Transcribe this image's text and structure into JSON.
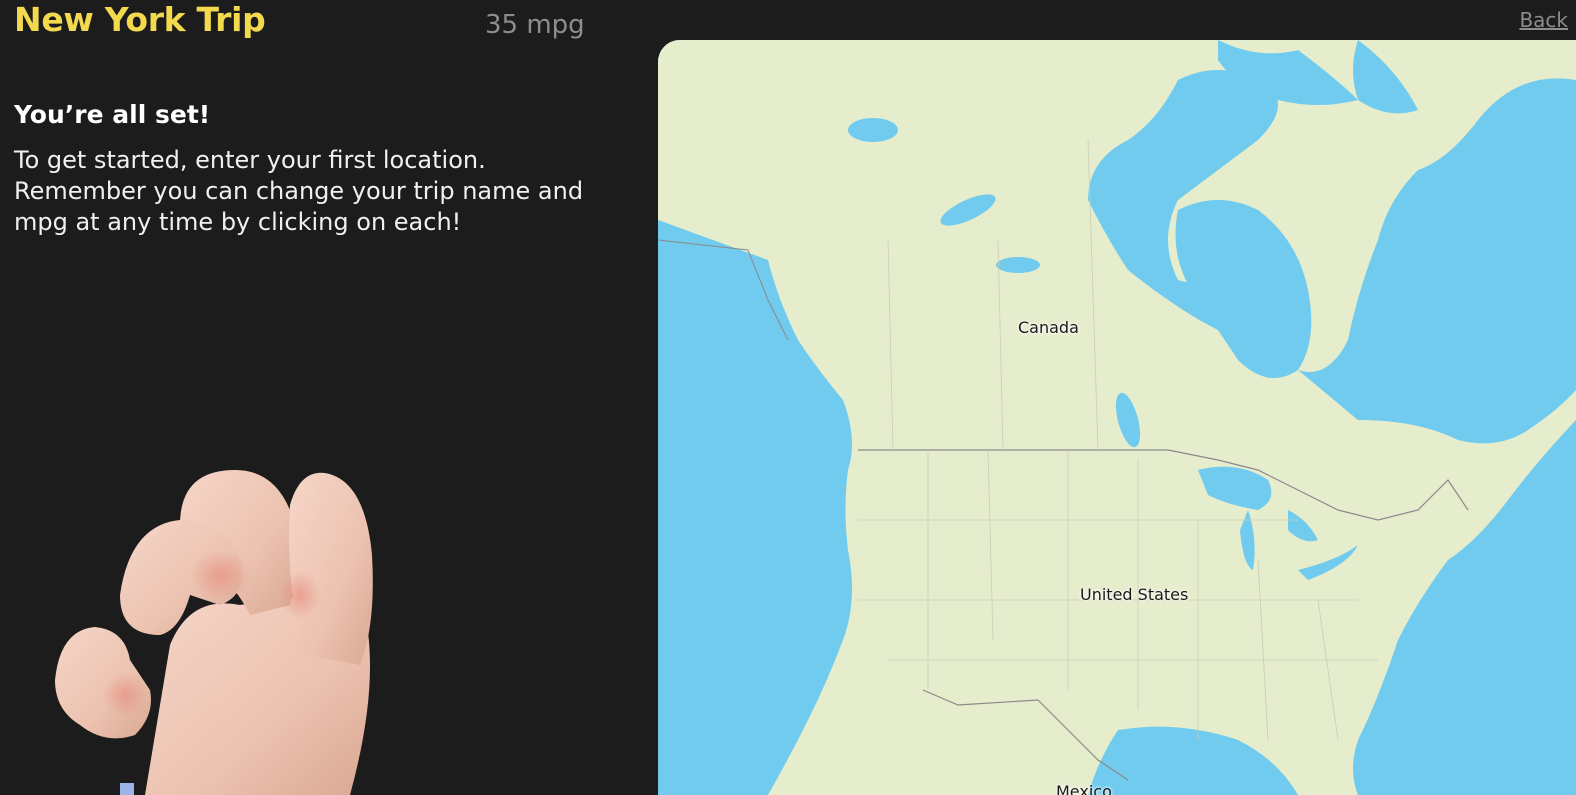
{
  "header": {
    "trip_name": "New York Trip",
    "mpg": "35 mpg",
    "back_label": "Back"
  },
  "intro": {
    "heading": "You’re all set!",
    "message": "To get started, enter your first location. Remember you can change your trip name and mpg at any time by clicking on each!"
  },
  "illustration": {
    "icon": "waving-hand-icon"
  },
  "map": {
    "labels": {
      "canada": "Canada",
      "united_states": "United States",
      "mexico": "Mexico"
    },
    "colors": {
      "water": "#70cbef",
      "land": "#e6edcc",
      "border": "#8a8a8a"
    }
  }
}
